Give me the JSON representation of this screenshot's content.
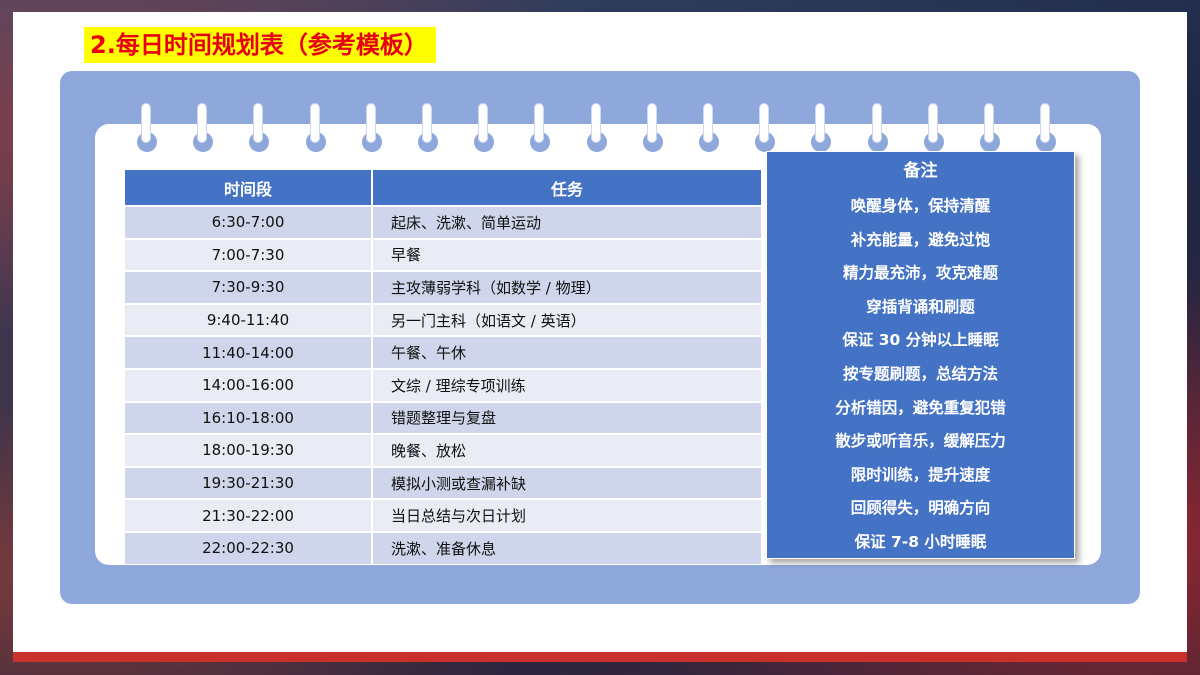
{
  "title": "2.每日时间规划表（参考模板）",
  "table": {
    "headers": {
      "time": "时间段",
      "task": "任务"
    },
    "rows": [
      {
        "time": "6:30-7:00",
        "task": "起床、洗漱、简单运动"
      },
      {
        "time": "7:00-7:30",
        "task": "早餐"
      },
      {
        "time": "7:30-9:30",
        "task": "主攻薄弱学科（如数学 / 物理）"
      },
      {
        "time": "9:40-11:40",
        "task": "另一门主科（如语文 / 英语）"
      },
      {
        "time": "11:40-14:00",
        "task": "午餐、午休"
      },
      {
        "time": "14:00-16:00",
        "task": "文综 / 理综专项训练"
      },
      {
        "time": "16:10-18:00",
        "task": "错题整理与复盘"
      },
      {
        "time": "18:00-19:30",
        "task": "晚餐、放松"
      },
      {
        "time": "19:30-21:30",
        "task": "模拟小测或查漏补缺"
      },
      {
        "time": "21:30-22:00",
        "task": "当日总结与次日计划"
      },
      {
        "time": "22:00-22:30",
        "task": "洗漱、准备休息"
      }
    ]
  },
  "notes": {
    "title": "备注",
    "items": [
      "唤醒身体，保持清醒",
      "补充能量，避免过饱",
      "精力最充沛，攻克难题",
      "穿插背诵和刷题",
      "保证 30 分钟以上睡眠",
      "按专题刷题，总结方法",
      "分析错因，避免重复犯错",
      "散步或听音乐，缓解压力",
      "限时训练，提升速度",
      "回顾得失，明确方向",
      "保证 7-8 小时睡眠"
    ]
  },
  "colors": {
    "title_text": "#e60012",
    "title_highlight": "#ffff00",
    "header_blue": "#4472c4",
    "panel_blue": "#8fa8db",
    "row_odd": "#cfd5ea",
    "row_even": "#e9ebf5"
  },
  "icons": {
    "binder_ring": "binder-ring-icon"
  }
}
